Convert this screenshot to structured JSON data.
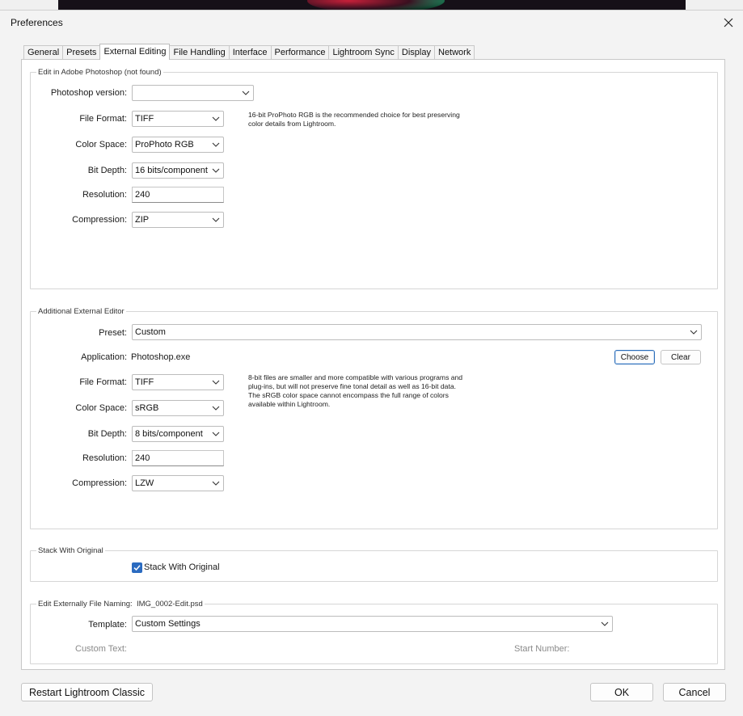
{
  "window": {
    "title": "Preferences"
  },
  "tabs": [
    {
      "label": "General"
    },
    {
      "label": "Presets"
    },
    {
      "label": "External Editing",
      "active": true
    },
    {
      "label": "File Handling"
    },
    {
      "label": "Interface"
    },
    {
      "label": "Performance"
    },
    {
      "label": "Lightroom Sync"
    },
    {
      "label": "Display"
    },
    {
      "label": "Network"
    }
  ],
  "photoshop_group": {
    "title": "Edit in Adobe Photoshop (not found)",
    "version_label": "Photoshop version:",
    "version_value": "",
    "file_format_label": "File Format:",
    "file_format": "TIFF",
    "color_space_label": "Color Space:",
    "color_space": "ProPhoto RGB",
    "bit_depth_label": "Bit Depth:",
    "bit_depth": "16 bits/component",
    "resolution_label": "Resolution:",
    "resolution": "240",
    "compression_label": "Compression:",
    "compression": "ZIP",
    "note_line1": "16-bit ProPhoto RGB is the recommended choice for best preserving",
    "note_line2": "color details from Lightroom."
  },
  "additional_group": {
    "title": "Additional External Editor",
    "preset_label": "Preset:",
    "preset": "Custom",
    "application_label": "Application:",
    "application": "Photoshop.exe",
    "choose_label": "Choose",
    "clear_label": "Clear",
    "file_format_label": "File Format:",
    "file_format": "TIFF",
    "color_space_label": "Color Space:",
    "color_space": "sRGB",
    "bit_depth_label": "Bit Depth:",
    "bit_depth": "8 bits/component",
    "resolution_label": "Resolution:",
    "resolution": "240",
    "compression_label": "Compression:",
    "compression": "LZW",
    "note_line1": "8-bit files are smaller and more compatible with various programs and",
    "note_line2": "plug-ins, but will not preserve fine tonal detail as well as 16-bit data.",
    "note_line3": "The sRGB color space cannot encompass the full range of colors",
    "note_line4": "available within Lightroom."
  },
  "stack_group": {
    "title": "Stack With Original",
    "checkbox_label": "Stack With Original",
    "checked": true
  },
  "naming_group": {
    "title": "Edit Externally File Naming:",
    "example": "IMG_0002-Edit.psd",
    "template_label": "Template:",
    "template": "Custom Settings",
    "custom_text_label": "Custom Text:",
    "start_number_label": "Start Number:"
  },
  "footer": {
    "restart_label": "Restart Lightroom Classic",
    "ok_label": "OK",
    "cancel_label": "Cancel"
  },
  "colors": {
    "accent": "#2b6bc0",
    "focus_border": "#2d6eb8"
  }
}
